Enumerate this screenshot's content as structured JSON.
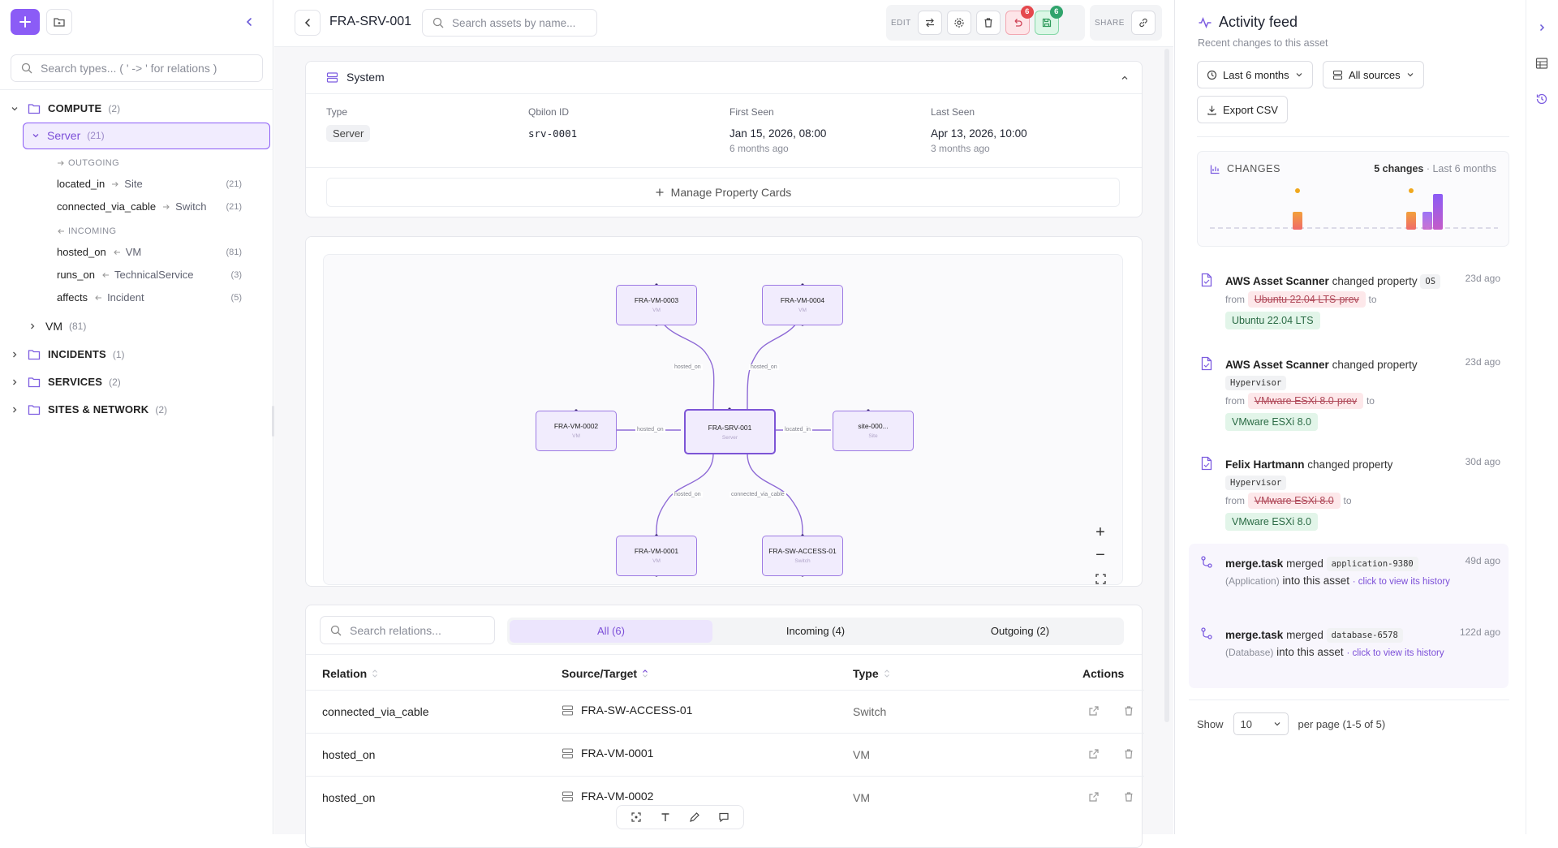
{
  "sidebar": {
    "search_placeholder": "Search types... ( ' -> ' for relations )",
    "categories": [
      {
        "label": "COMPUTE",
        "count": "(2)"
      },
      {
        "label": "INCIDENTS",
        "count": "(1)"
      },
      {
        "label": "SERVICES",
        "count": "(2)"
      },
      {
        "label": "SITES & NETWORK",
        "count": "(2)"
      }
    ],
    "selected_type": {
      "label": "Server",
      "count": "(21)"
    },
    "outgoing_label": "OUTGOING",
    "incoming_label": "INCOMING",
    "outgoing": [
      {
        "rel": "located_in",
        "target": "Site",
        "count": "(21)"
      },
      {
        "rel": "connected_via_cable",
        "target": "Switch",
        "count": "(21)"
      }
    ],
    "incoming": [
      {
        "rel": "hosted_on",
        "target": "VM",
        "count": "(81)"
      },
      {
        "rel": "runs_on",
        "target": "TechnicalService",
        "count": "(3)"
      },
      {
        "rel": "affects",
        "target": "Incident",
        "count": "(5)"
      }
    ],
    "vm_type": {
      "label": "VM",
      "count": "(81)"
    }
  },
  "topbar": {
    "title": "FRA-SRV-001",
    "search_placeholder": "Search assets by name...",
    "edit_label": "EDIT",
    "share_label": "SHARE",
    "undo_badge": "6",
    "save_badge": "6"
  },
  "system_card": {
    "title": "System",
    "fields": [
      {
        "label": "Type",
        "value": "Server",
        "sub": ""
      },
      {
        "label": "Qbilon ID",
        "value": "srv-0001",
        "sub": ""
      },
      {
        "label": "First Seen",
        "value": "Jan 15, 2026, 08:00",
        "sub": "6 months ago"
      },
      {
        "label": "Last Seen",
        "value": "Apr 13, 2026, 10:00",
        "sub": "3 months ago"
      }
    ],
    "manage_label": "Manage Property Cards"
  },
  "graph": {
    "nodes": [
      {
        "name": "FRA-VM-0003",
        "type": "VM"
      },
      {
        "name": "FRA-VM-0004",
        "type": "VM"
      },
      {
        "name": "FRA-VM-0002",
        "type": "VM"
      },
      {
        "name": "FRA-SRV-001",
        "type": "Server"
      },
      {
        "name": "site-000...",
        "type": "Site"
      },
      {
        "name": "FRA-VM-0001",
        "type": "VM"
      },
      {
        "name": "FRA-SW-ACCESS-01",
        "type": "Switch"
      }
    ],
    "edge_labels": [
      "hosted_on",
      "hosted_on",
      "hosted_on",
      "located_in",
      "hosted_on",
      "connected_via_cable"
    ]
  },
  "relations": {
    "search_placeholder": "Search relations...",
    "tabs": [
      "All (6)",
      "Incoming (4)",
      "Outgoing (2)"
    ],
    "columns": [
      "Relation",
      "Source/Target",
      "Type",
      "Actions"
    ],
    "rows": [
      {
        "relation": "connected_via_cable",
        "target": "FRA-SW-ACCESS-01",
        "type": "Switch"
      },
      {
        "relation": "hosted_on",
        "target": "FRA-VM-0001",
        "type": "VM"
      },
      {
        "relation": "hosted_on",
        "target": "FRA-VM-0002",
        "type": "VM"
      }
    ]
  },
  "feed": {
    "title": "Activity feed",
    "subtitle": "Recent changes to this asset",
    "range_label": "Last 6 months",
    "sources_label": "All sources",
    "export_label": "Export CSV",
    "changes_label": "CHANGES",
    "changes_count": "5 changes",
    "changes_range": "· Last 6 months",
    "items": [
      {
        "actor": "AWS Asset Scanner",
        "verb": "changed property",
        "prop": "OS",
        "time": "23d ago",
        "from": "Ubuntu 22.04 LTS-prev",
        "to": "Ubuntu 22.04 LTS"
      },
      {
        "actor": "AWS Asset Scanner",
        "verb": "changed property",
        "prop": "Hypervisor",
        "time": "23d ago",
        "from": "VMware ESXi 8.0-prev",
        "to": "VMware ESXi 8.0"
      },
      {
        "actor": "Felix Hartmann",
        "verb": "changed property",
        "prop": "Hypervisor",
        "time": "30d ago",
        "from": "VMware ESXi 8.0",
        "to": "VMware ESXi 8.0"
      }
    ],
    "merges": [
      {
        "actor": "merge.task",
        "verb": "merged",
        "obj": "application-9380",
        "kind": "(Application)",
        "text": "into this asset",
        "link": "· click to view its history",
        "time": "49d ago"
      },
      {
        "actor": "merge.task",
        "verb": "merged",
        "obj": "database-6578",
        "kind": "(Database)",
        "text": "into this asset",
        "link": "· click to view its history",
        "time": "122d ago"
      }
    ],
    "from_word": "from",
    "to_word": "to",
    "show_label": "Show",
    "page_size": "10",
    "per_page": "per page (1-5 of 5)"
  }
}
